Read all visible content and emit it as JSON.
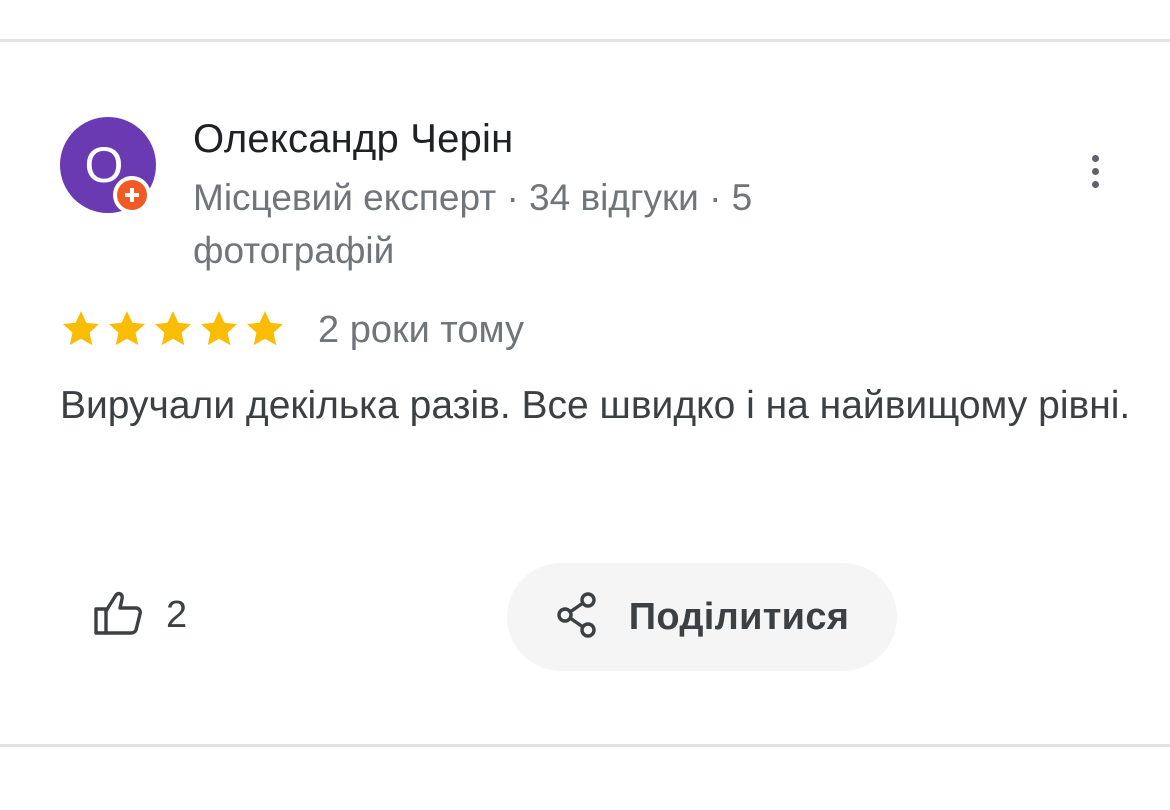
{
  "review": {
    "author": {
      "name": "Олександр Черін",
      "initial": "О",
      "avatar_color": "#6a3ab3",
      "badge_color": "#f15a24",
      "meta": "Місцевий експерт · 34 відгуки · 5 фотографій"
    },
    "rating": 5,
    "rating_max": 5,
    "star_color": "#fbbc04",
    "date": "2 роки тому",
    "text": "Виручали декілька разів. Все швидко і на найвищому рівні.",
    "likes": "2",
    "share_label": "Поділитися",
    "icons": {
      "more": "more-vert-icon",
      "like": "thumb-up-icon",
      "share": "share-icon",
      "badge": "local-guide-badge-icon"
    }
  }
}
